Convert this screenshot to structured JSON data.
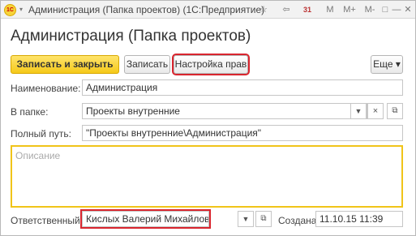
{
  "window": {
    "logo_text": "1С",
    "title": "Администрация (Папка проектов)  (1С:Предприятие)",
    "buttons": [
      "☆",
      "⇦",
      "31",
      "M",
      "M+",
      "M-",
      "□",
      "—",
      "✕"
    ]
  },
  "page_title": "Администрация (Папка проектов)",
  "toolbar": {
    "save_close_label": "Записать и закрыть",
    "save_label": "Записать",
    "access_label": "Настройка прав",
    "more_label": "Еще ▾"
  },
  "form": {
    "name_label": "Наименование:",
    "name_value": "Администрация",
    "folder_label": "В папке:",
    "folder_value": "Проекты внутренние",
    "path_label": "Полный путь:",
    "path_value": "\"Проекты внутренние\\Администрация\"",
    "description_placeholder": "Описание",
    "responsible_label": "Ответственный:",
    "responsible_value": "Кислых Валерий Михайлович",
    "created_label": "Создана:",
    "created_value": "11.10.15 11:39"
  },
  "colors": {
    "accent_yellow": "#f5c91a",
    "highlight_red": "#d9252e",
    "focus_border": "#f0c419"
  }
}
